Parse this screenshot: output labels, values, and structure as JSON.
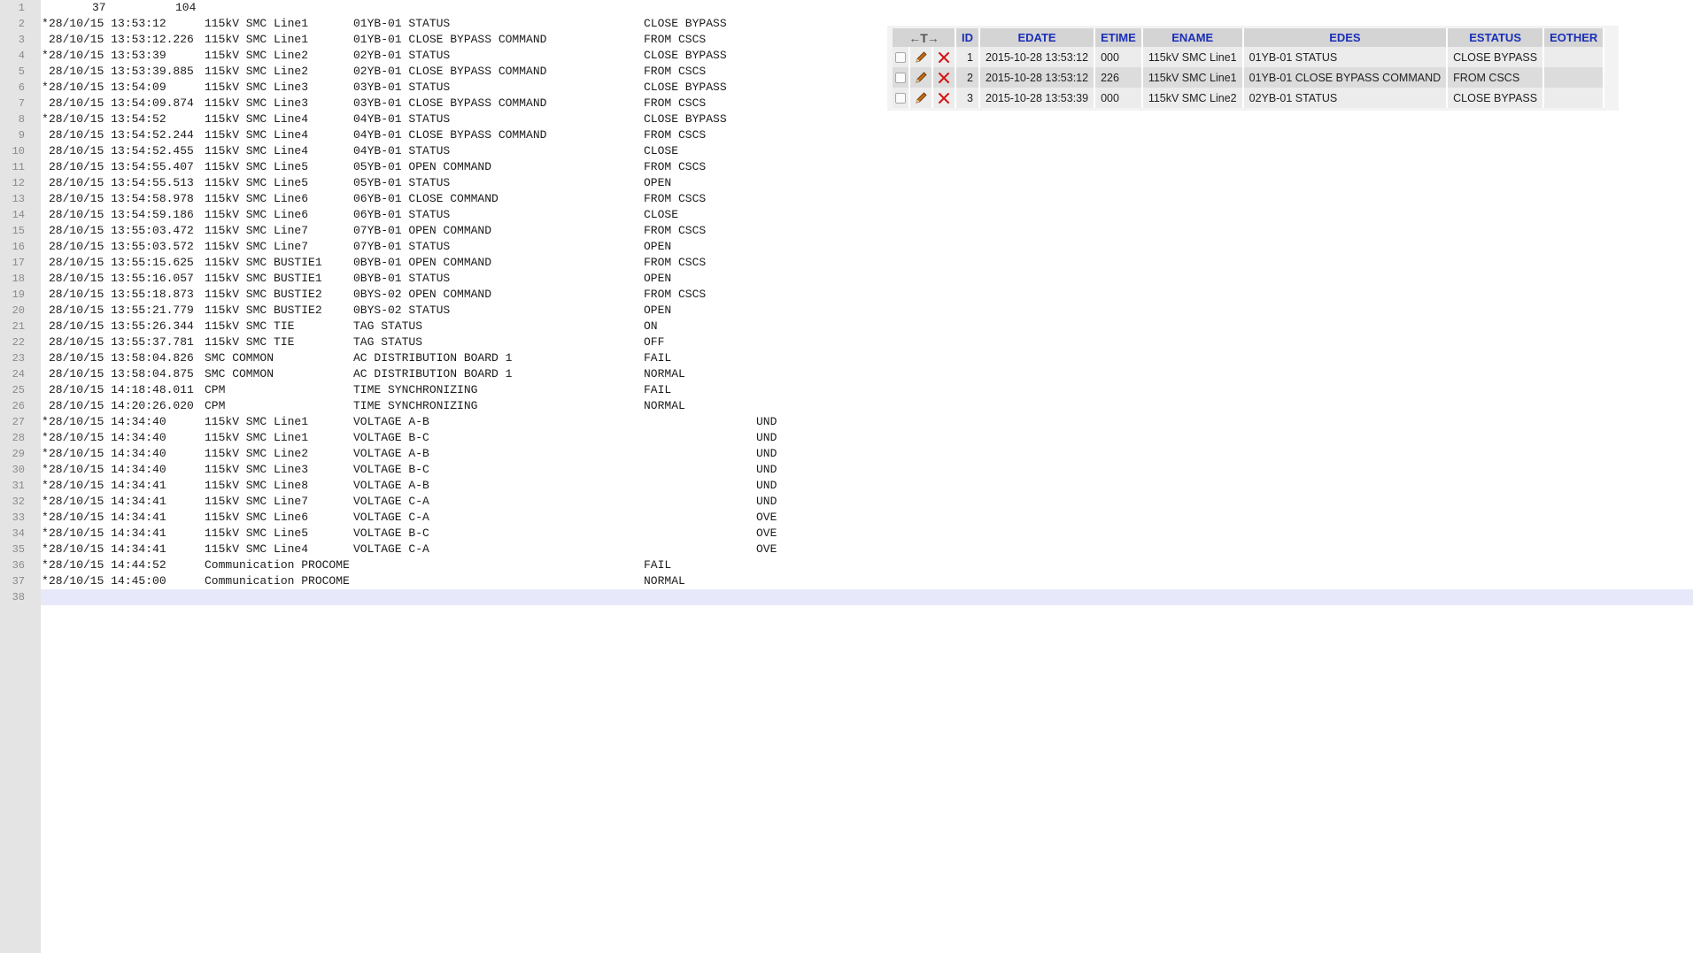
{
  "editor": {
    "header_line": {
      "number": "1",
      "left_value": "37",
      "right_value": "104"
    },
    "lines": [
      {
        "n": "2",
        "star": "*",
        "date": "28/10/15 13:53:12",
        "ename": "115kV SMC Line1",
        "edes": "01YB-01 STATUS",
        "status": "CLOSE BYPASS",
        "other": ""
      },
      {
        "n": "3",
        "star": "",
        "date": "28/10/15 13:53:12.226",
        "ename": "115kV SMC Line1",
        "edes": "01YB-01 CLOSE BYPASS COMMAND",
        "status": "FROM CSCS",
        "other": ""
      },
      {
        "n": "4",
        "star": "*",
        "date": "28/10/15 13:53:39",
        "ename": "115kV SMC Line2",
        "edes": "02YB-01 STATUS",
        "status": "CLOSE BYPASS",
        "other": ""
      },
      {
        "n": "5",
        "star": "",
        "date": "28/10/15 13:53:39.885",
        "ename": "115kV SMC Line2",
        "edes": "02YB-01 CLOSE BYPASS COMMAND",
        "status": "FROM CSCS",
        "other": ""
      },
      {
        "n": "6",
        "star": "*",
        "date": "28/10/15 13:54:09",
        "ename": "115kV SMC Line3",
        "edes": "03YB-01 STATUS",
        "status": "CLOSE BYPASS",
        "other": ""
      },
      {
        "n": "7",
        "star": "",
        "date": "28/10/15 13:54:09.874",
        "ename": "115kV SMC Line3",
        "edes": "03YB-01 CLOSE BYPASS COMMAND",
        "status": "FROM CSCS",
        "other": ""
      },
      {
        "n": "8",
        "star": "*",
        "date": "28/10/15 13:54:52",
        "ename": "115kV SMC Line4",
        "edes": "04YB-01 STATUS",
        "status": "CLOSE BYPASS",
        "other": ""
      },
      {
        "n": "9",
        "star": "",
        "date": "28/10/15 13:54:52.244",
        "ename": "115kV SMC Line4",
        "edes": "04YB-01 CLOSE BYPASS COMMAND",
        "status": "FROM CSCS",
        "other": ""
      },
      {
        "n": "10",
        "star": "",
        "date": "28/10/15 13:54:52.455",
        "ename": "115kV SMC Line4",
        "edes": "04YB-01 STATUS",
        "status": "CLOSE",
        "other": ""
      },
      {
        "n": "11",
        "star": "",
        "date": "28/10/15 13:54:55.407",
        "ename": "115kV SMC Line5",
        "edes": "05YB-01 OPEN COMMAND",
        "status": "FROM CSCS",
        "other": ""
      },
      {
        "n": "12",
        "star": "",
        "date": "28/10/15 13:54:55.513",
        "ename": "115kV SMC Line5",
        "edes": "05YB-01 STATUS",
        "status": "OPEN",
        "other": ""
      },
      {
        "n": "13",
        "star": "",
        "date": "28/10/15 13:54:58.978",
        "ename": "115kV SMC Line6",
        "edes": "06YB-01 CLOSE COMMAND",
        "status": "FROM CSCS",
        "other": ""
      },
      {
        "n": "14",
        "star": "",
        "date": "28/10/15 13:54:59.186",
        "ename": "115kV SMC Line6",
        "edes": "06YB-01 STATUS",
        "status": "CLOSE",
        "other": ""
      },
      {
        "n": "15",
        "star": "",
        "date": "28/10/15 13:55:03.472",
        "ename": "115kV SMC Line7",
        "edes": "07YB-01 OPEN COMMAND",
        "status": "FROM CSCS",
        "other": ""
      },
      {
        "n": "16",
        "star": "",
        "date": "28/10/15 13:55:03.572",
        "ename": "115kV SMC Line7",
        "edes": "07YB-01 STATUS",
        "status": "OPEN",
        "other": ""
      },
      {
        "n": "17",
        "star": "",
        "date": "28/10/15 13:55:15.625",
        "ename": "115kV SMC BUSTIE1",
        "edes": "0BYB-01 OPEN COMMAND",
        "status": "FROM CSCS",
        "other": ""
      },
      {
        "n": "18",
        "star": "",
        "date": "28/10/15 13:55:16.057",
        "ename": "115kV SMC BUSTIE1",
        "edes": "0BYB-01 STATUS",
        "status": "OPEN",
        "other": ""
      },
      {
        "n": "19",
        "star": "",
        "date": "28/10/15 13:55:18.873",
        "ename": "115kV SMC BUSTIE2",
        "edes": "0BYS-02 OPEN COMMAND",
        "status": "FROM CSCS",
        "other": ""
      },
      {
        "n": "20",
        "star": "",
        "date": "28/10/15 13:55:21.779",
        "ename": "115kV SMC BUSTIE2",
        "edes": "0BYS-02 STATUS",
        "status": "OPEN",
        "other": ""
      },
      {
        "n": "21",
        "star": "",
        "date": "28/10/15 13:55:26.344",
        "ename": "115kV SMC TIE",
        "edes": "TAG STATUS",
        "status": "ON",
        "other": ""
      },
      {
        "n": "22",
        "star": "",
        "date": "28/10/15 13:55:37.781",
        "ename": "115kV SMC TIE",
        "edes": "TAG STATUS",
        "status": "OFF",
        "other": ""
      },
      {
        "n": "23",
        "star": "",
        "date": "28/10/15 13:58:04.826",
        "ename": "SMC COMMON",
        "edes": "AC DISTRIBUTION BOARD 1",
        "status": "FAIL",
        "other": ""
      },
      {
        "n": "24",
        "star": "",
        "date": "28/10/15 13:58:04.875",
        "ename": "SMC COMMON",
        "edes": "AC DISTRIBUTION BOARD 1",
        "status": "NORMAL",
        "other": ""
      },
      {
        "n": "25",
        "star": "",
        "date": "28/10/15 14:18:48.011",
        "ename": "CPM",
        "edes": "TIME SYNCHRONIZING",
        "status": "FAIL",
        "other": ""
      },
      {
        "n": "26",
        "star": "",
        "date": "28/10/15 14:20:26.020",
        "ename": "CPM",
        "edes": "TIME SYNCHRONIZING",
        "status": "NORMAL",
        "other": ""
      },
      {
        "n": "27",
        "star": "*",
        "date": "28/10/15 14:34:40",
        "ename": "115kV SMC Line1",
        "edes": "VOLTAGE A-B",
        "status": "",
        "other": "UND"
      },
      {
        "n": "28",
        "star": "*",
        "date": "28/10/15 14:34:40",
        "ename": "115kV SMC Line1",
        "edes": "VOLTAGE B-C",
        "status": "",
        "other": "UND"
      },
      {
        "n": "29",
        "star": "*",
        "date": "28/10/15 14:34:40",
        "ename": "115kV SMC Line2",
        "edes": "VOLTAGE A-B",
        "status": "",
        "other": "UND"
      },
      {
        "n": "30",
        "star": "*",
        "date": "28/10/15 14:34:40",
        "ename": "115kV SMC Line3",
        "edes": "VOLTAGE B-C",
        "status": "",
        "other": "UND"
      },
      {
        "n": "31",
        "star": "*",
        "date": "28/10/15 14:34:41",
        "ename": "115kV SMC Line8",
        "edes": "VOLTAGE A-B",
        "status": "",
        "other": "UND"
      },
      {
        "n": "32",
        "star": "*",
        "date": "28/10/15 14:34:41",
        "ename": "115kV SMC Line7",
        "edes": "VOLTAGE C-A",
        "status": "",
        "other": "UND"
      },
      {
        "n": "33",
        "star": "*",
        "date": "28/10/15 14:34:41",
        "ename": "115kV SMC Line6",
        "edes": "VOLTAGE C-A",
        "status": "",
        "other": "OVE"
      },
      {
        "n": "34",
        "star": "*",
        "date": "28/10/15 14:34:41",
        "ename": "115kV SMC Line5",
        "edes": "VOLTAGE B-C",
        "status": "",
        "other": "OVE"
      },
      {
        "n": "35",
        "star": "*",
        "date": "28/10/15 14:34:41",
        "ename": "115kV SMC Line4",
        "edes": "VOLTAGE C-A",
        "status": "",
        "other": "OVE"
      },
      {
        "n": "36",
        "star": "*",
        "date": "28/10/15 14:44:52",
        "ename": "Communication PROCOME",
        "edes": "",
        "status": "FAIL",
        "other": ""
      },
      {
        "n": "37",
        "star": "*",
        "date": "28/10/15 14:45:00",
        "ename": "Communication PROCOME",
        "edes": "",
        "status": "NORMAL",
        "other": ""
      },
      {
        "n": "38",
        "star": "",
        "date": "",
        "ename": "",
        "edes": "",
        "status": "",
        "other": ""
      }
    ],
    "current_line": "38"
  },
  "grid": {
    "arrows": "←T→",
    "columns": [
      "ID",
      "EDATE",
      "ETIME",
      "ENAME",
      "EDES",
      "ESTATUS",
      "EOTHER"
    ],
    "rows": [
      {
        "id": "1",
        "edate": "2015-10-28 13:53:12",
        "etime": "000",
        "ename": "115kV SMC Line1",
        "edes": "01YB-01 STATUS",
        "estatus": "CLOSE BYPASS",
        "eother": ""
      },
      {
        "id": "2",
        "edate": "2015-10-28 13:53:12",
        "etime": "226",
        "ename": "115kV SMC Line1",
        "edes": "01YB-01 CLOSE BYPASS COMMAND",
        "estatus": "FROM CSCS",
        "eother": ""
      },
      {
        "id": "3",
        "edate": "2015-10-28 13:53:39",
        "etime": "000",
        "ename": "115kV SMC Line2",
        "edes": "02YB-01 STATUS",
        "estatus": "CLOSE BYPASS",
        "eother": ""
      }
    ],
    "colors": {
      "header_bg": "#d4d4d4",
      "header_text": "#1a2fb8",
      "edit_icon": "#c46a12",
      "delete_icon": "#d21414"
    }
  }
}
